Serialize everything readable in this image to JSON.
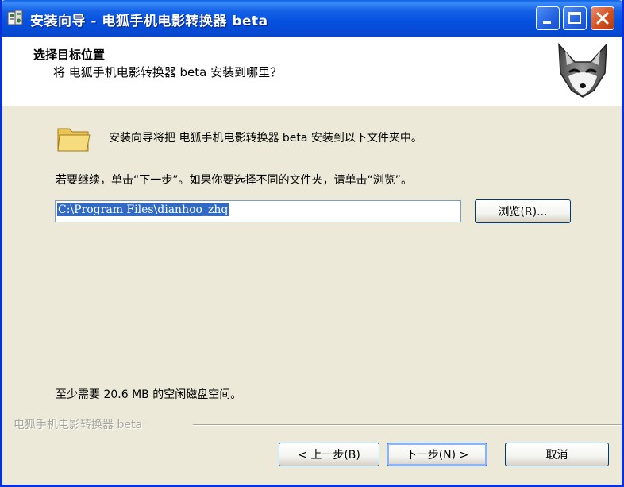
{
  "window": {
    "title": "安装向导 - 电狐手机电影转换器 beta",
    "controls": {
      "minimize": "minimize",
      "maximize": "maximize",
      "close": "close"
    }
  },
  "header": {
    "title": "选择目标位置",
    "subtitle": "将 电狐手机电影转换器 beta 安装到哪里？"
  },
  "body": {
    "intro_text": "安装向导将把 电狐手机电影转换器 beta 安装到以下文件夹中。",
    "continue_text": "若要继续，单击“下一步”。如果你要选择不同的文件夹，请单击“浏览”。",
    "install_path": "C:\\Program Files\\dianhoo_zhq",
    "browse_label": "浏览(R)...",
    "disk_space_text": "至少需要 20.6 MB 的空闲磁盘空间。"
  },
  "footer": {
    "brand": "电狐手机电影转换器 beta",
    "back_label": "< 上一步(B)",
    "next_label": "下一步(N) >",
    "cancel_label": "取消"
  },
  "colors": {
    "titlebar": "#0551df",
    "face": "#ece9d8",
    "selection": "#316ac5"
  },
  "icons": [
    "installer-app-icon",
    "fox-logo-icon",
    "folder-icon"
  ]
}
